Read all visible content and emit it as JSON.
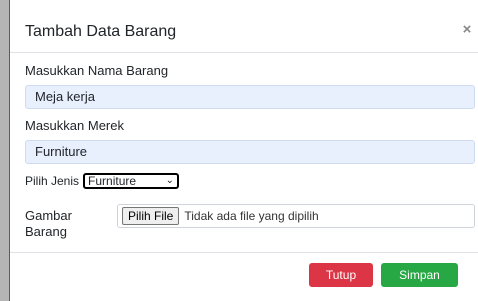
{
  "modal": {
    "title": "Tambah Data Barang",
    "close_symbol": "×"
  },
  "form": {
    "nama_label": "Masukkan Nama Barang",
    "nama_value": "Meja kerja",
    "merek_label": "Masukkan Merek",
    "merek_value": "Furniture",
    "jenis_label": "Pilih Jenis",
    "jenis_selected": "Furniture",
    "gambar_label": "Gambar Barang",
    "file_button": "Pilih File",
    "file_status": "Tidak ada file yang dipilih"
  },
  "footer": {
    "close_button": "Tutup",
    "save_button": "Simpan"
  },
  "colors": {
    "input_bg": "#e8f0fe",
    "danger": "#dc3545",
    "success": "#28a745"
  },
  "icons": {
    "close": "close-icon",
    "dropdown": "chevron-down-icon"
  }
}
